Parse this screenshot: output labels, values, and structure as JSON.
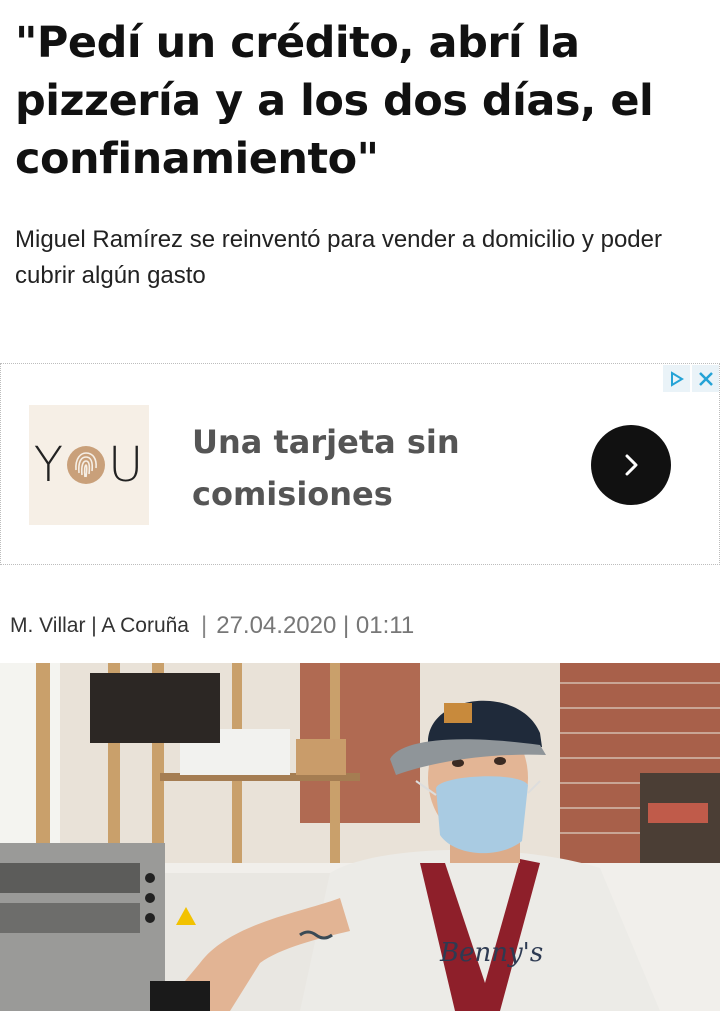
{
  "article": {
    "headline": "\"Pedí un crédito, abrí la pizzería y a los dos días, el confinamiento\"",
    "subtitle": "Miguel Ramírez se reinventó para vender a domicilio y poder cubrir algún gasto",
    "byline": {
      "author_location": "M. Villar | A Coruña",
      "separator": "|",
      "date_time": "27.04.2020 | 01:11"
    },
    "photo": {
      "apron_print": "Benny's"
    }
  },
  "ad": {
    "logo_text_left": "Y",
    "logo_text_right": "U",
    "headline": "Una tarjeta sin comisiones",
    "cta_icon": "chevron-right-icon",
    "choices_icons": [
      "adchoices-icon",
      "close-icon"
    ],
    "colors": {
      "cta_bg": "#111111",
      "logo_bg": "#f6efe6",
      "text": "#555555",
      "choices": "#25a3d6"
    }
  }
}
